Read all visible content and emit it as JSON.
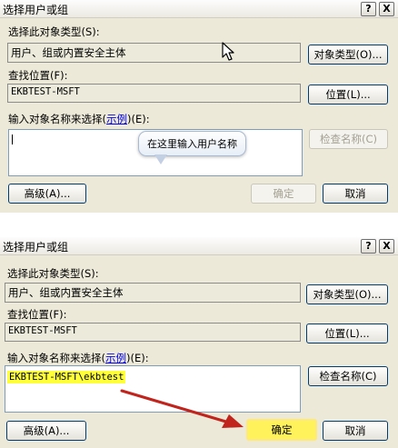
{
  "dialog1": {
    "title": "选择用户或组",
    "help_button": "?",
    "close_button": "X",
    "object_type_label": "选择此对象类型(S):",
    "object_type_value": "用户、组或内置安全主体",
    "object_types_button": "对象类型(O)...",
    "location_label": "查找位置(F):",
    "location_value": "EKBTEST-MSFT",
    "locations_button": "位置(L)...",
    "enter_names_label_prefix": "输入对象名称来选择",
    "examples_link": "示例",
    "enter_names_label_suffix": "(E):",
    "names_value": "",
    "tooltip": "在这里输入用户名称",
    "check_names_button": "检查名称(C)",
    "advanced_button": "高级(A)...",
    "ok_button": "确定",
    "cancel_button": "取消"
  },
  "dialog2": {
    "title": "选择用户或组",
    "help_button": "?",
    "close_button": "X",
    "object_type_label": "选择此对象类型(S):",
    "object_type_value": "用户、组或内置安全主体",
    "object_types_button": "对象类型(O)...",
    "location_label": "查找位置(F):",
    "location_value": "EKBTEST-MSFT",
    "locations_button": "位置(L)...",
    "enter_names_label_prefix": "输入对象名称来选择",
    "examples_link": "示例",
    "enter_names_label_suffix": "(E):",
    "names_value": "EKBTEST-MSFT\\ekbtest",
    "check_names_button": "检查名称(C)",
    "advanced_button": "高级(A)...",
    "ok_button": "确定",
    "cancel_button": "取消"
  },
  "colors": {
    "dialog_bg": "#ece9d8",
    "highlight": "#ffff3a",
    "arrow": "#c0241c",
    "link": "#0000ee"
  },
  "icons": [
    "help-icon",
    "close-icon",
    "mouse-pointer-icon",
    "red-arrow-icon"
  ]
}
